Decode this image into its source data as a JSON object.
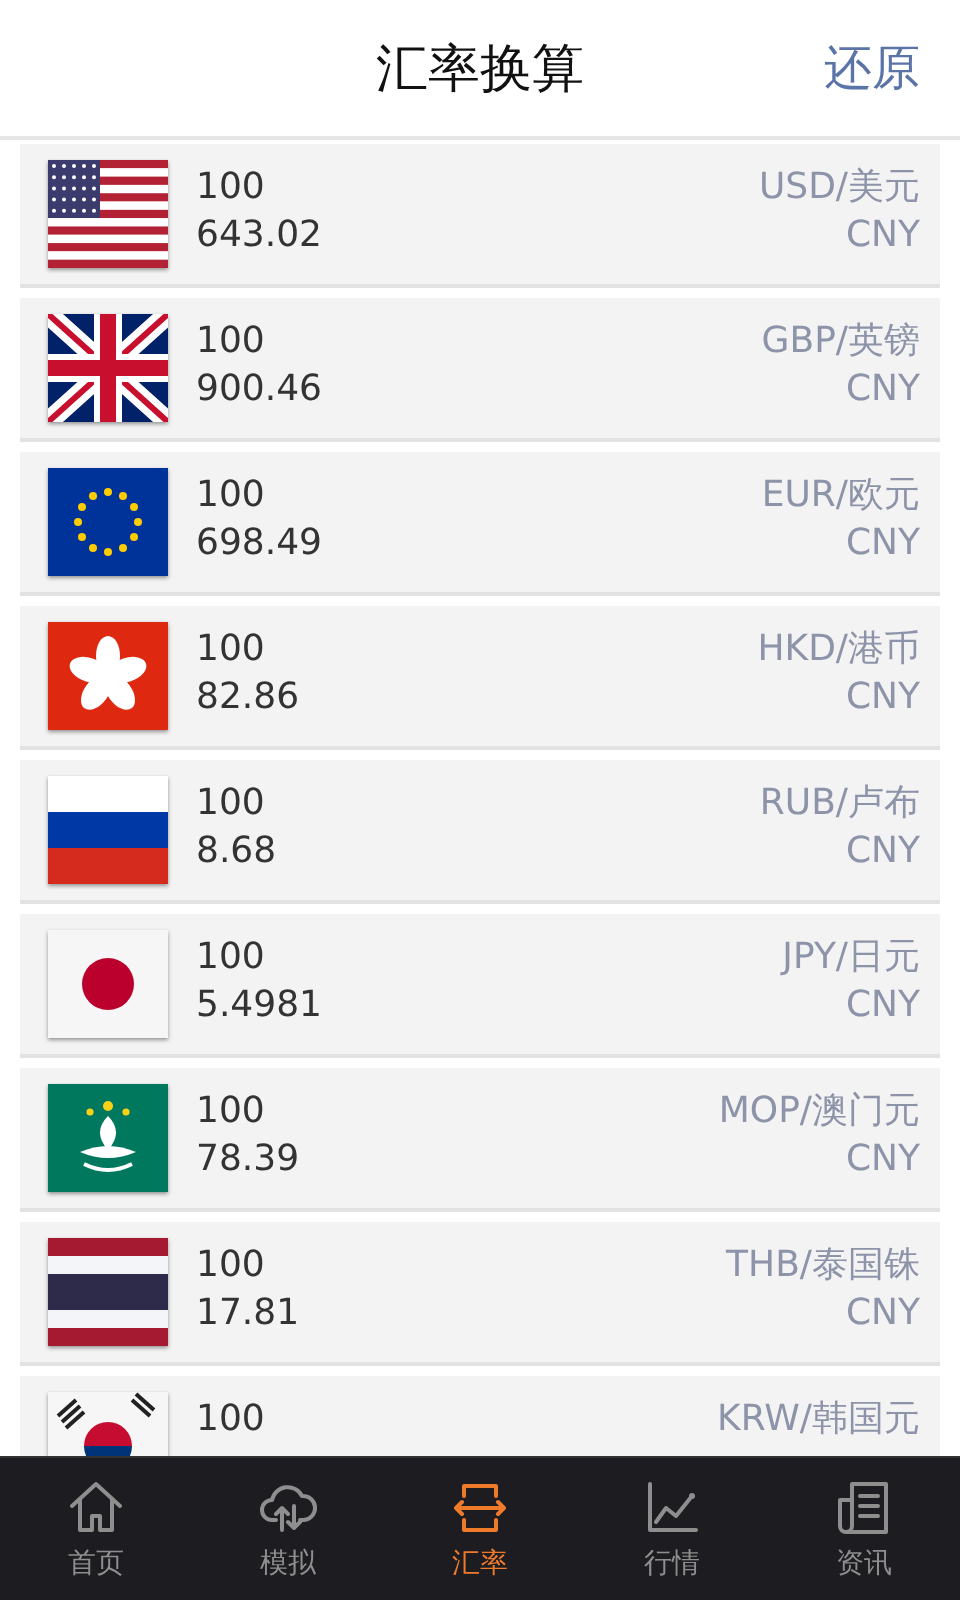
{
  "header": {
    "title": "汇率换算",
    "action": "还原"
  },
  "rates": [
    {
      "kind": "us",
      "amount": "100",
      "result": "643.02",
      "pair": "USD/美元",
      "target": "CNY"
    },
    {
      "kind": "gb",
      "amount": "100",
      "result": "900.46",
      "pair": "GBP/英镑",
      "target": "CNY"
    },
    {
      "kind": "eu",
      "amount": "100",
      "result": "698.49",
      "pair": "EUR/欧元",
      "target": "CNY"
    },
    {
      "kind": "hk",
      "amount": "100",
      "result": "82.86",
      "pair": "HKD/港币",
      "target": "CNY"
    },
    {
      "kind": "ru",
      "amount": "100",
      "result": "8.68",
      "pair": "RUB/卢布",
      "target": "CNY"
    },
    {
      "kind": "jp",
      "amount": "100",
      "result": "5.4981",
      "pair": "JPY/日元",
      "target": "CNY"
    },
    {
      "kind": "mo",
      "amount": "100",
      "result": "78.39",
      "pair": "MOP/澳门元",
      "target": "CNY"
    },
    {
      "kind": "th",
      "amount": "100",
      "result": "17.81",
      "pair": "THB/泰国铢",
      "target": "CNY"
    },
    {
      "kind": "kr",
      "amount": "100",
      "pair": "KRW/韩国元"
    }
  ],
  "tabs": [
    {
      "kind": "home",
      "label": "首页",
      "selected": false
    },
    {
      "kind": "cloud",
      "label": "模拟",
      "selected": false
    },
    {
      "kind": "exchange",
      "label": "汇率",
      "selected": true
    },
    {
      "kind": "chart",
      "label": "行情",
      "selected": false
    },
    {
      "kind": "news",
      "label": "资讯",
      "selected": false
    }
  ]
}
